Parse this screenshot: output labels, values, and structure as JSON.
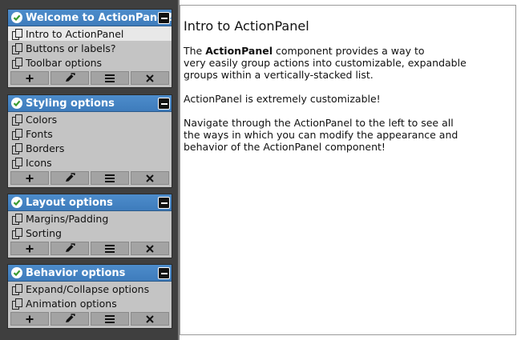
{
  "colors": {
    "sidebar_bg": "#3f3f3f",
    "header_bg": "#4183c4",
    "group_bg": "#c4c4c4",
    "check_green": "#3a9b2f"
  },
  "groups": [
    {
      "title": "Welcome to ActionPanel!",
      "items": [
        "Intro to ActionPanel",
        "Buttons or labels?",
        "Toolbar options"
      ]
    },
    {
      "title": "Styling options",
      "items": [
        "Colors",
        "Fonts",
        "Borders",
        "Icons"
      ]
    },
    {
      "title": "Layout options",
      "items": [
        "Margins/Padding",
        "Sorting"
      ]
    },
    {
      "title": "Behavior options",
      "items": [
        "Expand/Collapse options",
        "Animation options"
      ]
    }
  ],
  "toolbar_icons": [
    "plus-icon",
    "edit-icon",
    "menu-icon",
    "close-icon"
  ],
  "selected_item": "Intro to ActionPanel",
  "content": {
    "title": "Intro to ActionPanel",
    "p1_prefix": "The ",
    "p1_bold": "ActionPanel",
    "p1_line1_rest": " component provides a way to",
    "p1_line2": "very easily group actions into customizable, expandable",
    "p1_line3": "groups within a vertically-stacked list.",
    "p2": "ActionPanel is extremely customizable!",
    "p3_line1": "Navigate through the ActionPanel to the left to see all",
    "p3_line2": "the ways in which you can modify the appearance and",
    "p3_line3": "behavior of the ActionPanel component!"
  }
}
